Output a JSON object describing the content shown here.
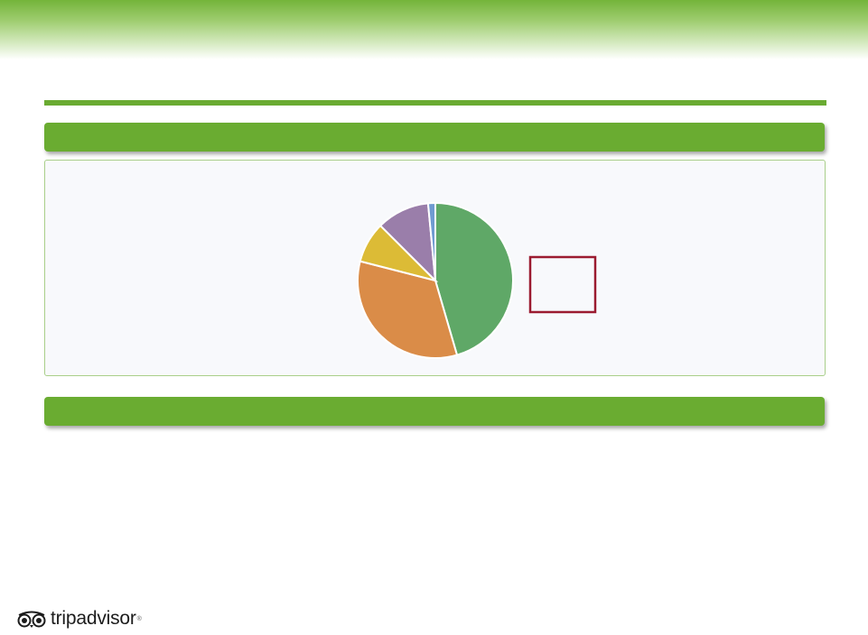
{
  "colors": {
    "accent_green": "#6aac31",
    "panel_border": "#a9cf8a",
    "legend_box_border": "#9b1b30"
  },
  "logo": {
    "text": "tripadvisor",
    "icon": "owl-eyes-icon"
  },
  "chart_data": {
    "type": "pie",
    "start_angle_deg": 0,
    "direction": "clockwise",
    "slice_border": "#ffffff",
    "slices": [
      {
        "value": 45.5,
        "color": "#5fa867"
      },
      {
        "value": 33.5,
        "color": "#da8c48"
      },
      {
        "value": 8.5,
        "color": "#dcbb36"
      },
      {
        "value": 11.0,
        "color": "#9a7eaa"
      },
      {
        "value": 1.5,
        "color": "#6f9bd1"
      }
    ],
    "legend": {
      "entries": [],
      "placement": "right"
    }
  }
}
